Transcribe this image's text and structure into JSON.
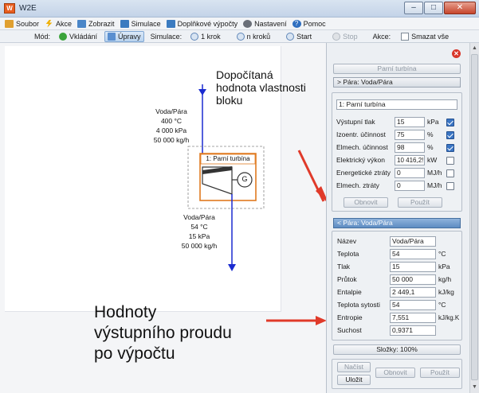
{
  "window": {
    "title": "W2E",
    "app_icon": "w2e-logo-icon"
  },
  "menu": {
    "items": [
      {
        "label": "Soubor",
        "icon": "folder-icon",
        "color": "#e0a030"
      },
      {
        "label": "Akce",
        "icon": "lightning-icon",
        "color": "#f0b000"
      },
      {
        "label": "Zobrazit",
        "icon": "view-icon",
        "color": "#4a86c8"
      },
      {
        "label": "Simulace",
        "icon": "simulation-icon",
        "color": "#3b7bc0"
      },
      {
        "label": "Doplňkové výpočty",
        "icon": "calculator-icon",
        "color": "#3b7bc0"
      },
      {
        "label": "Nastavení",
        "icon": "gear-icon",
        "color": "#6a6f78"
      },
      {
        "label": "Pomoc",
        "icon": "help-icon",
        "color": "#2f6fc0"
      }
    ]
  },
  "toolbar": {
    "mode_label": "Mód:",
    "insert_label": "Vkládání",
    "edit_label": "Úpravy",
    "simulation_label": "Simulace:",
    "step1_label": "1 krok",
    "stepn_label": "n kroků",
    "start_label": "Start",
    "stop_label": "Stop",
    "actions_label": "Akce:",
    "delete_all_label": "Smazat vše"
  },
  "diagram": {
    "inlet_stream": {
      "name": "Voda/Pára",
      "temperature": "400 °C",
      "pressure": "4 000 kPa",
      "flow": "50 000 kg/h"
    },
    "block_title": "1: Parní turbína",
    "generator_symbol": "G",
    "outlet_stream": {
      "name": "Voda/Pára",
      "temperature": "54 °C",
      "pressure": "15 kPa",
      "flow": "50 000 kg/h"
    },
    "colors": {
      "stream": "#1a2bd0",
      "block_frame": "#e07a20",
      "turbine": "#333333"
    }
  },
  "annotations": {
    "top": [
      "Dopočítaná",
      "hodnota vlastnosti",
      "bloku"
    ],
    "bottom": [
      "Hodnoty",
      "výstupního proudu",
      "po výpočtu"
    ],
    "arrow_color": "#e03a2a"
  },
  "panel": {
    "header_button": "Parní turbína",
    "section_top_label": "> Pára: Voda/Pára",
    "block_name": "1: Parní turbína",
    "block_fields": [
      {
        "label": "Výstupní tlak",
        "value": "15",
        "unit": "kPa",
        "checked": true
      },
      {
        "label": "Izoentr. účinnost",
        "value": "75",
        "unit": "%",
        "checked": true
      },
      {
        "label": "Elmech. účinnost",
        "value": "98",
        "unit": "%",
        "checked": true
      },
      {
        "label": "Elektrický výkon",
        "value": "10 416,2!",
        "unit": "kW",
        "checked": false
      },
      {
        "label": "Energetické ztráty",
        "value": "0",
        "unit": "MJ/h",
        "checked": false
      },
      {
        "label": "Elmech. ztráty",
        "value": "0",
        "unit": "MJ/h",
        "checked": false
      }
    ],
    "refresh_label": "Obnovit",
    "use_label": "Použít",
    "section_stream_label": "< Pára: Voda/Pára",
    "stream_fields": [
      {
        "label": "Název",
        "value": "Voda/Pára",
        "unit": ""
      },
      {
        "label": "Teplota",
        "value": "54",
        "unit": "°C"
      },
      {
        "label": "Tlak",
        "value": "15",
        "unit": "kPa"
      },
      {
        "label": "Průtok",
        "value": "50 000",
        "unit": "kg/h"
      },
      {
        "label": "Entalpie",
        "value": "2 449,1",
        "unit": "kJ/kg"
      },
      {
        "label": "Teplota sytosti",
        "value": "54",
        "unit": "°C"
      },
      {
        "label": "Entropie",
        "value": "7,551",
        "unit": "kJ/kg.K"
      },
      {
        "label": "Suchost",
        "value": "0,9371",
        "unit": ""
      }
    ],
    "components_label": "Složky: 100%",
    "load_label": "Načíst",
    "save_label": "Uložit",
    "refresh2_label": "Obnovit",
    "use2_label": "Použít"
  }
}
